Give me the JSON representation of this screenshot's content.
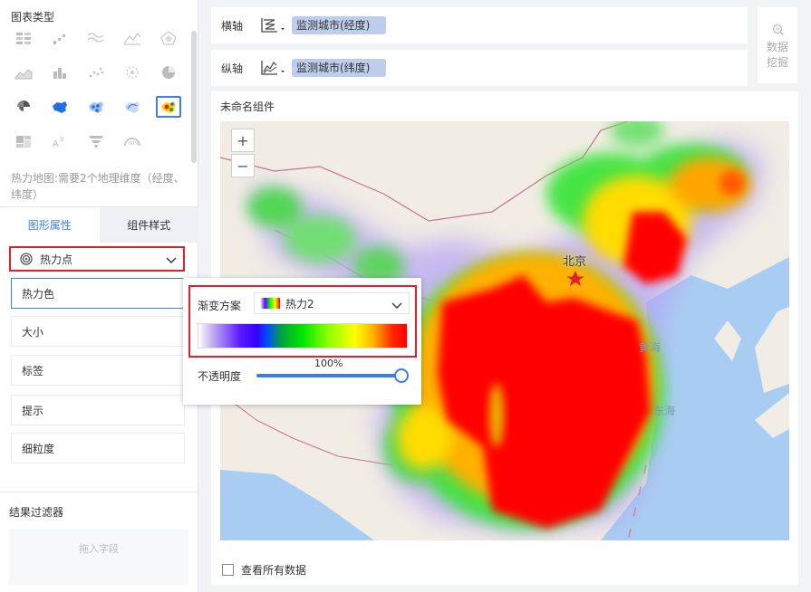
{
  "left": {
    "chart_type_title": "图表类型",
    "hint": "热力地图:需要2个地理维度（经度、纬度）",
    "tabs": [
      "图形属性",
      "组件样式"
    ],
    "mark_type": "热力点",
    "properties": [
      "热力色",
      "大小",
      "标签",
      "提示",
      "细粒度"
    ],
    "filter_title": "结果过滤器",
    "drop_placeholder": "拖入字段",
    "chart_types": [
      "table-icon",
      "bar-grid-icon",
      "wave-line-icon",
      "mountain-line-icon",
      "radar-icon",
      "area-icon",
      "column-icon",
      "scatter-icon",
      "dot-ring-icon",
      "pie-icon",
      "rose-icon",
      "china-map-icon",
      "point-map-icon",
      "flow-map-icon",
      "heat-map-icon",
      "treemap-icon",
      "word-cloud-icon",
      "funnel-icon",
      "gauge-icon"
    ],
    "selected_chart_type": "heat-map-icon"
  },
  "axes": {
    "x_label": "横轴",
    "x_field": "监测城市(经度)",
    "y_label": "纵轴",
    "y_field": "监测城市(纬度)"
  },
  "mining": {
    "line1": "数据",
    "line2": "挖掘"
  },
  "widget": {
    "title": "未命名组件",
    "zoom_in": "+",
    "zoom_out": "−",
    "capital_label": "北京",
    "sea_1": "黄海",
    "sea_2": "东海",
    "see_all": "查看所有数据"
  },
  "popup": {
    "gradient_label": "渐变方案",
    "gradient_value": "热力2",
    "opacity_label": "不透明度",
    "opacity_value": "100%",
    "opacity_fraction": 1.0
  },
  "colors": {
    "accent": "#3d7de8",
    "highlight_box": "#e0202a",
    "field_pill": "#bfcdec"
  }
}
